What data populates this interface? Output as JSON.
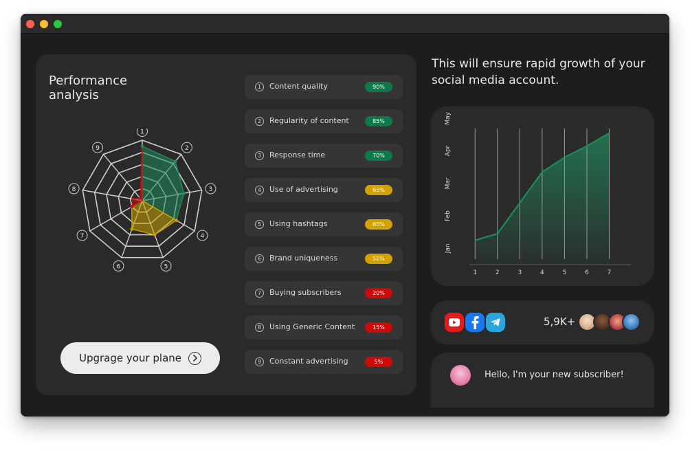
{
  "window": {
    "controls": [
      "close",
      "minimize",
      "zoom"
    ]
  },
  "performance": {
    "title": "Performance analysis",
    "axis_labels": [
      "1",
      "2",
      "3",
      "4",
      "5",
      "6",
      "7",
      "8",
      "9"
    ],
    "metrics": [
      {
        "num": "1",
        "label": "Content quality",
        "value": "90%",
        "fraction": 0.9,
        "color": "#0e7a4b"
      },
      {
        "num": "2",
        "label": "Regularity of content",
        "value": "85%",
        "fraction": 0.85,
        "color": "#0e7a4b"
      },
      {
        "num": "3",
        "label": "Response time",
        "value": "70%",
        "fraction": 0.7,
        "color": "#0e7a4b"
      },
      {
        "num": "4",
        "label": "Use of advertising",
        "value": "65%",
        "fraction": 0.65,
        "color": "#d2a200"
      },
      {
        "num": "5",
        "label": "Using hashtags",
        "value": "60%",
        "fraction": 0.6,
        "color": "#d2a200"
      },
      {
        "num": "6",
        "label": "Brand uniqueness",
        "value": "50%",
        "fraction": 0.5,
        "color": "#d2a200"
      },
      {
        "num": "7",
        "label": "Buying subscribers",
        "value": "20%",
        "fraction": 0.2,
        "color": "#cc0a0a"
      },
      {
        "num": "8",
        "label": "Using Generic Content",
        "value": "15%",
        "fraction": 0.15,
        "color": "#cc0a0a"
      },
      {
        "num": "9",
        "label": "Constant advertising",
        "value": "5%",
        "fraction": 0.05,
        "color": "#cc0a0a"
      }
    ],
    "upgrade_label": "Upgrage your plane",
    "colors": {
      "good": "#1f8a5b",
      "medium": "#c9a000",
      "bad": "#c21111"
    }
  },
  "growth": {
    "headline": "This will ensure rapid growth of your social media account."
  },
  "chart_data": {
    "type": "area",
    "x": [
      1,
      2,
      3,
      4,
      5,
      6,
      7
    ],
    "categories": [
      "Jan",
      "Feb",
      "Mar",
      "Apr",
      "May"
    ],
    "values": [
      1.25,
      1.45,
      2.4,
      3.35,
      3.8,
      4.15,
      4.55
    ],
    "xlabel": "",
    "ylabel": "",
    "xlim": [
      0.5,
      8
    ],
    "ylim": [
      0.5,
      4.9
    ],
    "grid": "vertical",
    "color": "#1f8a5b"
  },
  "social": {
    "apps": [
      "youtube-icon",
      "facebook-icon",
      "telegram-icon"
    ],
    "count": "5,9K+",
    "avatars": 4
  },
  "subscriber": {
    "message": "Hello, I'm your new subscriber!"
  }
}
